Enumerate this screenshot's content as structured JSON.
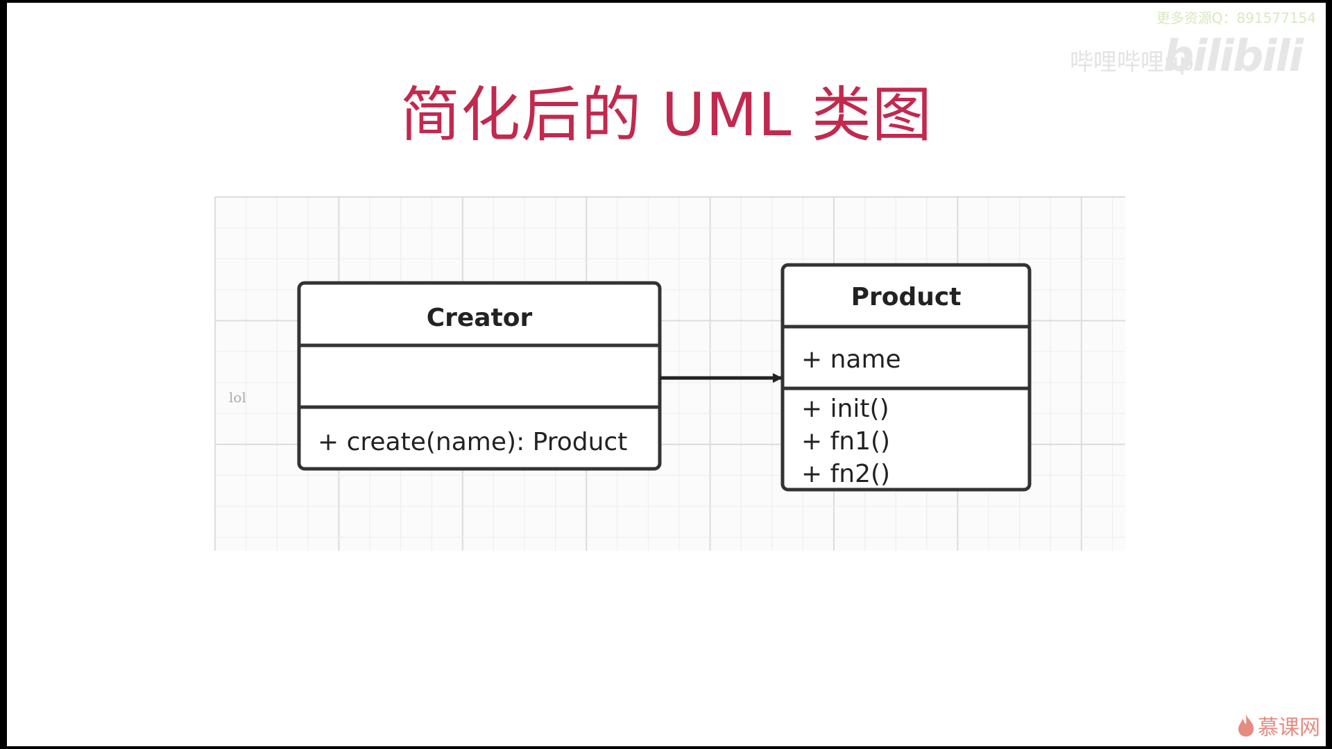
{
  "slide": {
    "title": "简化后的 UML 类图",
    "title_color": "#c2294e"
  },
  "watermarks": {
    "top_right_text": "更多资源Q：891577154",
    "up_text": "哔哩哔哩up",
    "bilibili_logo": "bilibili",
    "imooc_logo": "慕课网",
    "imooc_icon": "flame-icon"
  },
  "diagram": {
    "grid_note": "lol",
    "classes": [
      {
        "name": "Creator",
        "attributes": [],
        "methods": [
          "+ create(name): Product"
        ]
      },
      {
        "name": "Product",
        "attributes": [
          "+ name"
        ],
        "methods": [
          "+ init()",
          "+ fn1()",
          "+ fn2()"
        ]
      }
    ],
    "relation": {
      "from": "Creator",
      "to": "Product",
      "type": "association-arrow"
    }
  }
}
